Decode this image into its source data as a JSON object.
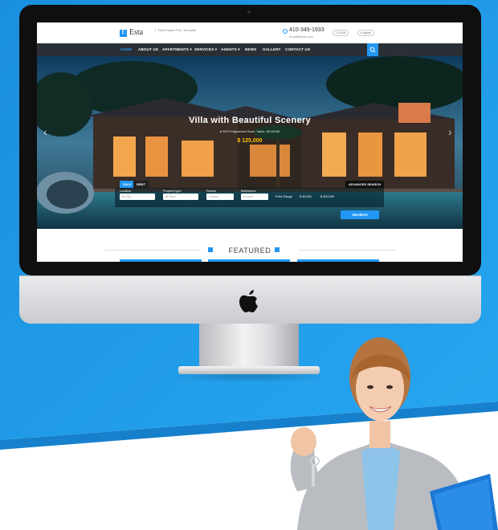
{
  "site": {
    "logo_text": "Esta",
    "tagline": "Real Estate PSD Template",
    "phone": "410-349-1933",
    "email": "email@esta.com",
    "login": "LOGIN",
    "language": "English"
  },
  "nav": {
    "items": [
      {
        "label": "HOME"
      },
      {
        "label": "ABOUT US"
      },
      {
        "label": "APARTMENTS ▾"
      },
      {
        "label": "SERVICES ▾"
      },
      {
        "label": "AGENTS ▾"
      },
      {
        "label": "NEWS"
      },
      {
        "label": "GALLERY"
      },
      {
        "label": "CONTACT US"
      }
    ]
  },
  "hero": {
    "title": "Villa with Beautiful Scenery",
    "address": "8070 Edgewood Road, Taylor, MI 48180",
    "price": "$ 125,000"
  },
  "search": {
    "tabs": [
      "SALE",
      "RENT"
    ],
    "advanced_label": "ADVANCED SEARCH",
    "fields": [
      {
        "label": "Location",
        "placeholder": "All City"
      },
      {
        "label": "Property type",
        "placeholder": "All Style"
      },
      {
        "label": "Rooms",
        "placeholder": "Choose"
      },
      {
        "label": "Bathrooms",
        "placeholder": "Choose"
      }
    ],
    "price_range_label": "Price Range",
    "price_min": "$ 35,000",
    "price_max": "$ 300,000",
    "button_label": "SEARCH"
  },
  "featured": {
    "title": "FEATURED"
  },
  "colors": {
    "accent": "#2196f3",
    "nav_bg": "#2a2f35",
    "price": "#ffc107",
    "backdrop_blue": "#1e9be8"
  },
  "icons": [
    "phone-icon",
    "search-icon",
    "pin-icon",
    "apple-logo-icon",
    "chevron-left-icon",
    "chevron-right-icon"
  ]
}
